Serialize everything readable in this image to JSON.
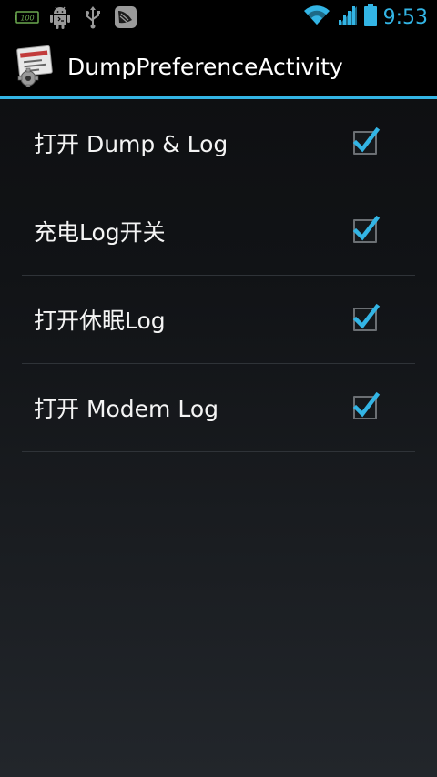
{
  "status_bar": {
    "time": "9:53",
    "icons": [
      "battery-full-icon",
      "android-debug-icon",
      "usb-icon",
      "hourglass-icon",
      "wifi-icon",
      "signal-icon",
      "battery-icon"
    ],
    "battery_label": "100"
  },
  "action_bar": {
    "title": "DumpPreferenceActivity",
    "icon": "preferences-app-icon"
  },
  "preferences": [
    {
      "label": "打开 Dump & Log",
      "checked": true
    },
    {
      "label": "充电Log开关",
      "checked": true
    },
    {
      "label": "打开休眠Log",
      "checked": true
    },
    {
      "label": "打开 Modem Log",
      "checked": true
    }
  ],
  "colors": {
    "accent": "#33b5e5",
    "background": "#000000",
    "text": "#ffffff"
  }
}
